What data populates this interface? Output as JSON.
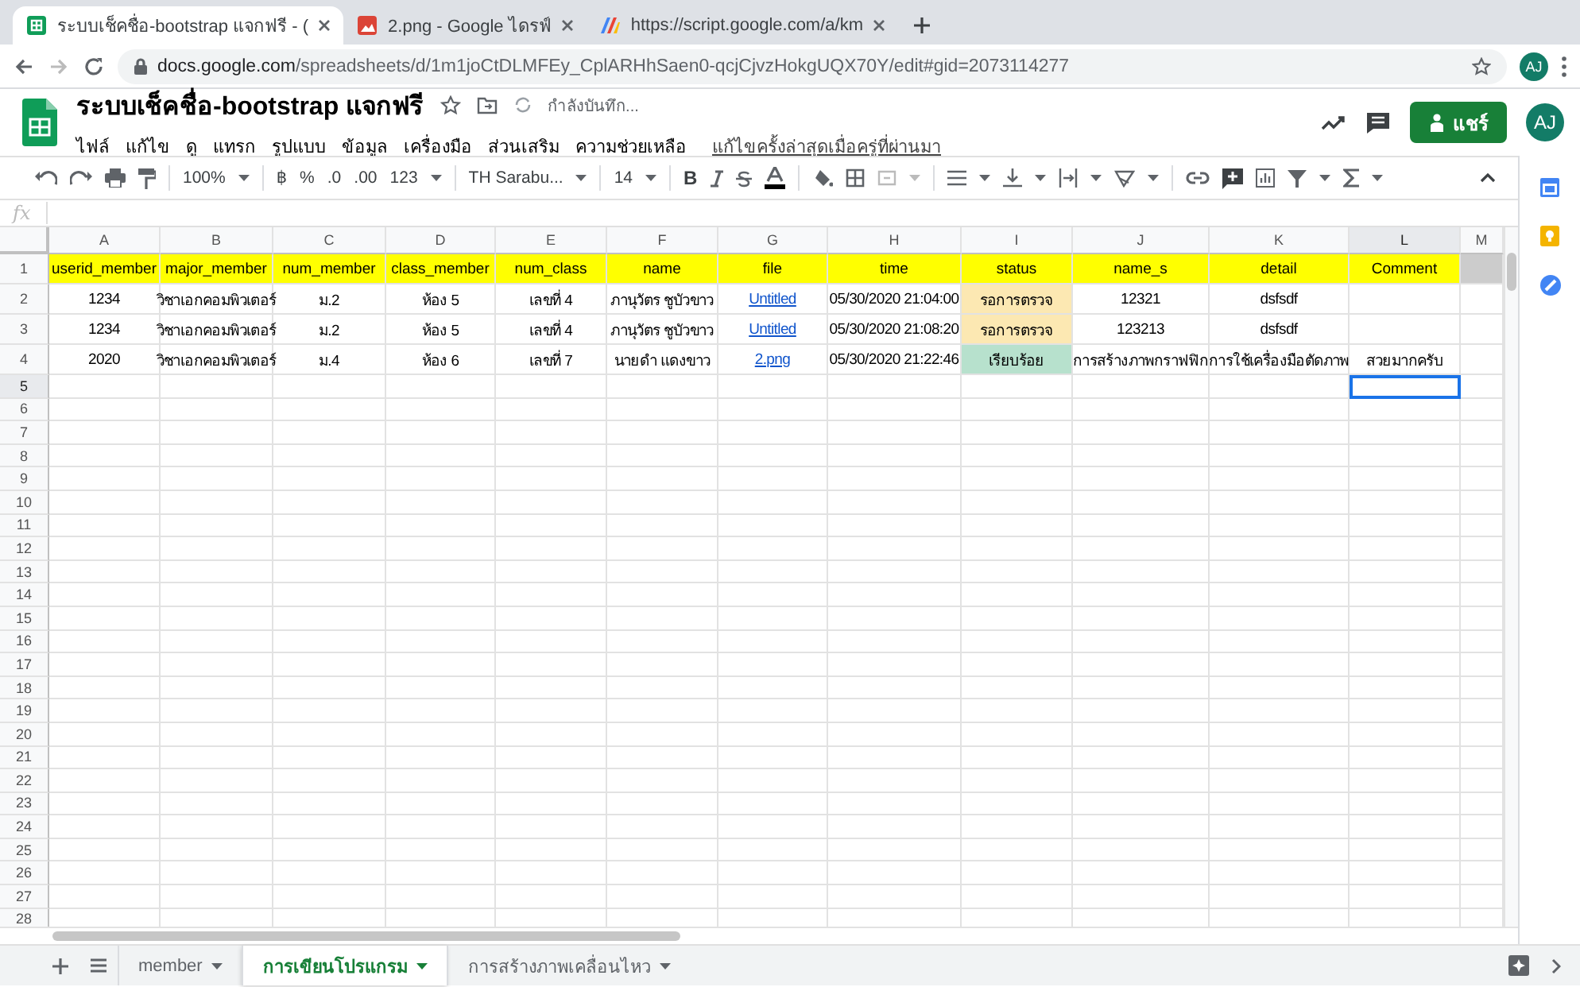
{
  "browser": {
    "tabs": [
      {
        "kind": "sheets",
        "title": "ระบบเช็คชื่อ-bootstrap แจกฟรี - (",
        "selected": true
      },
      {
        "kind": "drive",
        "title": "2.png - Google ไดรฟ์",
        "selected": false
      },
      {
        "kind": "script",
        "title": "https://script.google.com/a/km",
        "selected": false
      }
    ],
    "address": {
      "host": "docs.google.com",
      "path": "/spreadsheets/d/1m1joCtDLMFEy_CplARHhSaen0-qcjCjvzHokgUQX70Y/edit#gid=2073114277"
    },
    "avatar": "AJ"
  },
  "document": {
    "title": "ระบบเช็คชื่อ-bootstrap แจกฟรี",
    "save_status": "กำลังบันทึก...",
    "menu": [
      "ไฟล์",
      "แก้ไข",
      "ดู",
      "แทรก",
      "รูปแบบ",
      "ข้อมูล",
      "เครื่องมือ",
      "ส่วนเสริม",
      "ความช่วยเหลือ"
    ],
    "last_edit": "แก้ไขครั้งล่าสุดเมื่อครู่ที่ผ่านมา",
    "share": "แชร์",
    "avatar": "AJ"
  },
  "toolbar": {
    "bold": "B",
    "zoom": "100%",
    "currency": "฿",
    "percent": "%",
    "decrease_decimals": ".0",
    "increase_decimals": ".00",
    "number_format": "123",
    "font": "TH Sarabu...",
    "font_size": "14"
  },
  "formula_bar": {
    "label": "fx"
  },
  "columns": [
    {
      "letter": "A",
      "selected": false
    },
    {
      "letter": "B",
      "selected": false
    },
    {
      "letter": "C",
      "selected": false
    },
    {
      "letter": "D",
      "selected": false
    },
    {
      "letter": "E",
      "selected": false
    },
    {
      "letter": "F",
      "selected": false
    },
    {
      "letter": "G",
      "selected": false
    },
    {
      "letter": "H",
      "selected": false
    },
    {
      "letter": "I",
      "selected": false
    },
    {
      "letter": "J",
      "selected": false
    },
    {
      "letter": "K",
      "selected": false
    },
    {
      "letter": "L",
      "selected": true
    },
    {
      "letter": "M",
      "selected": false
    }
  ],
  "rows": [
    {
      "number": "1",
      "selected": false,
      "cells": [
        {
          "text": "userid_member",
          "color": "#ffff00"
        },
        {
          "text": "major_member",
          "color": "#ffff00"
        },
        {
          "text": "num_member",
          "color": "#ffff00"
        },
        {
          "text": "class_member",
          "color": "#ffff00"
        },
        {
          "text": "num_class",
          "color": "#ffff00"
        },
        {
          "text": "name",
          "color": "#ffff00"
        },
        {
          "text": "file",
          "color": "#ffff00"
        },
        {
          "text": "time",
          "color": "#ffff00"
        },
        {
          "text": "status",
          "color": "#ffff00"
        },
        {
          "text": "name_s",
          "color": "#ffff00"
        },
        {
          "text": "detail",
          "color": "#ffff00"
        },
        {
          "text": "Comment",
          "color": "#ffff00"
        },
        {
          "color": "#cccccc"
        }
      ]
    },
    {
      "number": "2",
      "selected": false,
      "cells": [
        {
          "text": "1234"
        },
        {
          "text": "วิชาเอกคอมพิวเตอร์"
        },
        {
          "text": "ม.2"
        },
        {
          "text": "ห้อง 5"
        },
        {
          "text": "เลขที่ 4"
        },
        {
          "text": "ภานุวัตร ชูบัวขาว"
        },
        {
          "text": "Untitled",
          "kind": "link"
        },
        {
          "text": "05/30/2020 21:04:00"
        },
        {
          "text": "รอการตรวจ",
          "color": "#fce8b2"
        },
        {
          "text": "12321"
        },
        {
          "text": "dsfsdf"
        }
      ]
    },
    {
      "number": "3",
      "selected": false,
      "cells": [
        {
          "text": "1234"
        },
        {
          "text": "วิชาเอกคอมพิวเตอร์"
        },
        {
          "text": "ม.2"
        },
        {
          "text": "ห้อง 5"
        },
        {
          "text": "เลขที่ 4"
        },
        {
          "text": "ภานุวัตร ชูบัวขาว"
        },
        {
          "text": "Untitled",
          "kind": "link"
        },
        {
          "text": "05/30/2020 21:08:20"
        },
        {
          "text": "รอการตรวจ",
          "color": "#fce8b2"
        },
        {
          "text": "123213"
        },
        {
          "text": "dsfsdf"
        }
      ]
    },
    {
      "number": "4",
      "selected": false,
      "cells": [
        {
          "text": "2020"
        },
        {
          "text": "วิชาเอกคอมพิวเตอร์"
        },
        {
          "text": "ม.4"
        },
        {
          "text": "ห้อง 6"
        },
        {
          "text": "เลขที่ 7"
        },
        {
          "text": "นายดำ แดงขาว"
        },
        {
          "text": "2.png",
          "kind": "link"
        },
        {
          "text": "05/30/2020 21:22:46"
        },
        {
          "text": "เรียบร้อย",
          "color": "#b7e1cd"
        },
        {
          "text": "การสร้างภาพกราฟฟิก"
        },
        {
          "text": "การใช้เครื่องมือตัดภาพ"
        },
        {
          "text": "สวยมากครับ"
        }
      ]
    },
    {
      "number": "5",
      "selected": true
    },
    {
      "number": "6",
      "selected": false
    },
    {
      "number": "7",
      "selected": false
    },
    {
      "number": "8",
      "selected": false
    },
    {
      "number": "9",
      "selected": false
    },
    {
      "number": "10",
      "selected": false
    },
    {
      "number": "11",
      "selected": false
    },
    {
      "number": "12",
      "selected": false
    },
    {
      "number": "13",
      "selected": false
    },
    {
      "number": "14",
      "selected": false
    },
    {
      "number": "15",
      "selected": false
    },
    {
      "number": "16",
      "selected": false
    },
    {
      "number": "17",
      "selected": false
    },
    {
      "number": "18",
      "selected": false
    },
    {
      "number": "19",
      "selected": false
    },
    {
      "number": "20",
      "selected": false
    },
    {
      "number": "21",
      "selected": false
    },
    {
      "number": "22",
      "selected": false
    },
    {
      "number": "23",
      "selected": false
    },
    {
      "number": "24",
      "selected": false
    },
    {
      "number": "25",
      "selected": false
    },
    {
      "number": "26",
      "selected": false
    },
    {
      "number": "27",
      "selected": false
    },
    {
      "number": "28",
      "selected": false
    }
  ],
  "sheets": [
    {
      "name": "member",
      "selected": false
    },
    {
      "name": "การเขียนโปรแกรม",
      "selected": true
    },
    {
      "name": "การสร้างภาพเคลื่อนไหว",
      "selected": false
    }
  ]
}
